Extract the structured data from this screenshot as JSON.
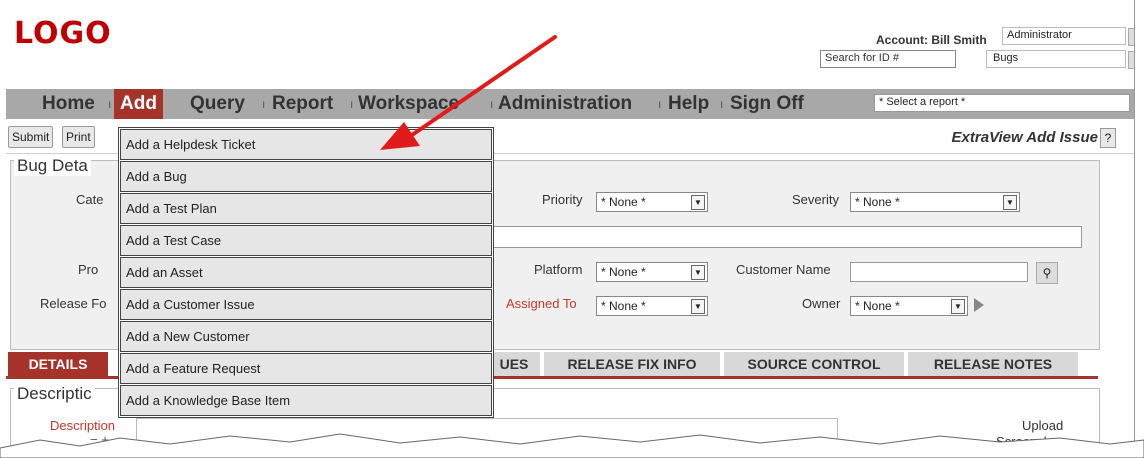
{
  "header": {
    "logo": "LOGO",
    "account_label": "Account: Bill Smith",
    "role": "Administrator",
    "search_placeholder": "Search for ID #",
    "area": "Bugs"
  },
  "nav": {
    "items": [
      "Home",
      "Add",
      "Query",
      "Report",
      "Workspace",
      "Administration",
      "Help",
      "Sign Off"
    ],
    "active": "Add",
    "report_select": "* Select a report *"
  },
  "toolbar": {
    "submit": "Submit",
    "print": "Print",
    "title": "ExtraView Add Issue",
    "help": "?"
  },
  "bug_details": {
    "title": "Bug Deta",
    "labels": {
      "category": "Cate",
      "product": "Pro",
      "release_found": "Release Fo",
      "priority": "Priority",
      "severity": "Severity",
      "platform": "Platform",
      "customer_name": "Customer Name",
      "assigned_to": "Assigned To",
      "owner": "Owner"
    },
    "values": {
      "priority": "* None *",
      "severity": "* None *",
      "platform": "* None *",
      "assigned_to": "* None *",
      "owner": "* None *"
    }
  },
  "tabs": [
    "DETAILS",
    "UES",
    "RELEASE FIX INFO",
    "SOURCE CONTROL",
    "RELEASE NOTES"
  ],
  "description": {
    "title": "Descriptic",
    "field_label": "Description",
    "minus_plus": "− +",
    "upload": "Upload",
    "screenshot": "Screenshot"
  },
  "add_menu": [
    "Add a Helpdesk Ticket",
    "Add a Bug",
    "Add a Test Plan",
    "Add a Test Case",
    "Add an Asset",
    "Add a Customer Issue",
    "Add a New Customer",
    "Add a Feature Request",
    "Add a Knowledge Base Item"
  ],
  "colors": {
    "brand": "#c00000",
    "active_nav": "#a5332a",
    "nav_bg": "#a8a8a8",
    "annotation_arrow": "#e11b1b"
  }
}
